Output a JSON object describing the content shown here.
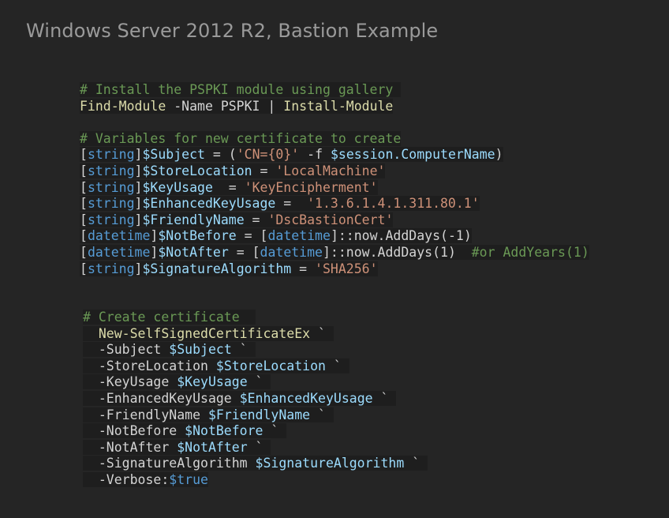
{
  "title": "Windows Server 2012 R2, Bastion Example",
  "colors": {
    "background": "#252525",
    "code_bg": "#1e1e1e",
    "comment": "#6a9955",
    "keyword": "#dcdcaa",
    "type": "#569cd6",
    "variable": "#9cdcfe",
    "string": "#ce9178",
    "text": "#d4d4d4"
  },
  "code_blocks": [
    {
      "lines": [
        [
          {
            "t": "comment",
            "v": "# Install the PSPKI module using gallery "
          }
        ],
        [
          {
            "t": "keyword",
            "v": "Find-Module"
          },
          {
            "t": "plain",
            "v": " -Name PSPKI | "
          },
          {
            "t": "keyword",
            "v": "Install-Module"
          }
        ],
        [],
        [
          {
            "t": "comment",
            "v": "# Variables for new certificate to create"
          }
        ],
        [
          {
            "t": "punct",
            "v": "["
          },
          {
            "t": "type",
            "v": "string"
          },
          {
            "t": "punct",
            "v": "]"
          },
          {
            "t": "var",
            "v": "$Subject"
          },
          {
            "t": "plain",
            "v": " = ("
          },
          {
            "t": "string",
            "v": "'CN={0}'"
          },
          {
            "t": "plain",
            "v": " -f "
          },
          {
            "t": "var",
            "v": "$session.ComputerName"
          },
          {
            "t": "plain",
            "v": ")"
          }
        ],
        [
          {
            "t": "punct",
            "v": "["
          },
          {
            "t": "type",
            "v": "string"
          },
          {
            "t": "punct",
            "v": "]"
          },
          {
            "t": "var",
            "v": "$StoreLocation"
          },
          {
            "t": "plain",
            "v": " = "
          },
          {
            "t": "string",
            "v": "'LocalMachine'"
          }
        ],
        [
          {
            "t": "punct",
            "v": "["
          },
          {
            "t": "type",
            "v": "string"
          },
          {
            "t": "punct",
            "v": "]"
          },
          {
            "t": "var",
            "v": "$KeyUsage"
          },
          {
            "t": "plain",
            "v": "  = "
          },
          {
            "t": "string",
            "v": "'KeyEncipherment'"
          }
        ],
        [
          {
            "t": "punct",
            "v": "["
          },
          {
            "t": "type",
            "v": "string"
          },
          {
            "t": "punct",
            "v": "]"
          },
          {
            "t": "var",
            "v": "$EnhancedKeyUsage"
          },
          {
            "t": "plain",
            "v": " =  "
          },
          {
            "t": "string",
            "v": "'1.3.6.1.4.1.311.80.1'"
          }
        ],
        [
          {
            "t": "punct",
            "v": "["
          },
          {
            "t": "type",
            "v": "string"
          },
          {
            "t": "punct",
            "v": "]"
          },
          {
            "t": "var",
            "v": "$FriendlyName"
          },
          {
            "t": "plain",
            "v": " = "
          },
          {
            "t": "string",
            "v": "'DscBastionCert'"
          }
        ],
        [
          {
            "t": "punct",
            "v": "["
          },
          {
            "t": "type",
            "v": "datetime"
          },
          {
            "t": "punct",
            "v": "]"
          },
          {
            "t": "var",
            "v": "$NotBefore"
          },
          {
            "t": "plain",
            "v": " = ["
          },
          {
            "t": "type",
            "v": "datetime"
          },
          {
            "t": "plain",
            "v": "]::now.AddDays(-1)"
          }
        ],
        [
          {
            "t": "punct",
            "v": "["
          },
          {
            "t": "type",
            "v": "datetime"
          },
          {
            "t": "punct",
            "v": "]"
          },
          {
            "t": "var",
            "v": "$NotAfter"
          },
          {
            "t": "plain",
            "v": " = ["
          },
          {
            "t": "type",
            "v": "datetime"
          },
          {
            "t": "plain",
            "v": "]::now.AddDays(1)  "
          },
          {
            "t": "comment",
            "v": "#or AddYears(1)"
          }
        ],
        [
          {
            "t": "punct",
            "v": "["
          },
          {
            "t": "type",
            "v": "string"
          },
          {
            "t": "punct",
            "v": "]"
          },
          {
            "t": "var",
            "v": "$SignatureAlgorithm"
          },
          {
            "t": "plain",
            "v": " = "
          },
          {
            "t": "string",
            "v": "'SHA256'"
          }
        ]
      ]
    },
    {
      "lines": [
        [
          {
            "t": "comment",
            "v": "# Create certificate  "
          }
        ],
        [
          {
            "t": "plain",
            "v": "  "
          },
          {
            "t": "keyword",
            "v": "New-SelfSignedCertificateEx"
          },
          {
            "t": "plain",
            "v": " ` "
          }
        ],
        [
          {
            "t": "plain",
            "v": "  -Subject "
          },
          {
            "t": "var",
            "v": "$Subject"
          },
          {
            "t": "plain",
            "v": " ` "
          }
        ],
        [
          {
            "t": "plain",
            "v": "  -StoreLocation "
          },
          {
            "t": "var",
            "v": "$StoreLocation"
          },
          {
            "t": "plain",
            "v": " ` "
          }
        ],
        [
          {
            "t": "plain",
            "v": "  -KeyUsage "
          },
          {
            "t": "var",
            "v": "$KeyUsage"
          },
          {
            "t": "plain",
            "v": " ` "
          }
        ],
        [
          {
            "t": "plain",
            "v": "  -EnhancedKeyUsage "
          },
          {
            "t": "var",
            "v": "$EnhancedKeyUsage"
          },
          {
            "t": "plain",
            "v": " ` "
          }
        ],
        [
          {
            "t": "plain",
            "v": "  -FriendlyName "
          },
          {
            "t": "var",
            "v": "$FriendlyName"
          },
          {
            "t": "plain",
            "v": " ` "
          }
        ],
        [
          {
            "t": "plain",
            "v": "  -NotBefore "
          },
          {
            "t": "var",
            "v": "$NotBefore"
          },
          {
            "t": "plain",
            "v": " ` "
          }
        ],
        [
          {
            "t": "plain",
            "v": "  -NotAfter "
          },
          {
            "t": "var",
            "v": "$NotAfter"
          },
          {
            "t": "plain",
            "v": " ` "
          }
        ],
        [
          {
            "t": "plain",
            "v": "  -SignatureAlgorithm "
          },
          {
            "t": "var",
            "v": "$SignatureAlgorithm"
          },
          {
            "t": "plain",
            "v": " ` "
          }
        ],
        [
          {
            "t": "plain",
            "v": "  -Verbose:"
          },
          {
            "t": "bool",
            "v": "$true"
          }
        ]
      ]
    }
  ]
}
